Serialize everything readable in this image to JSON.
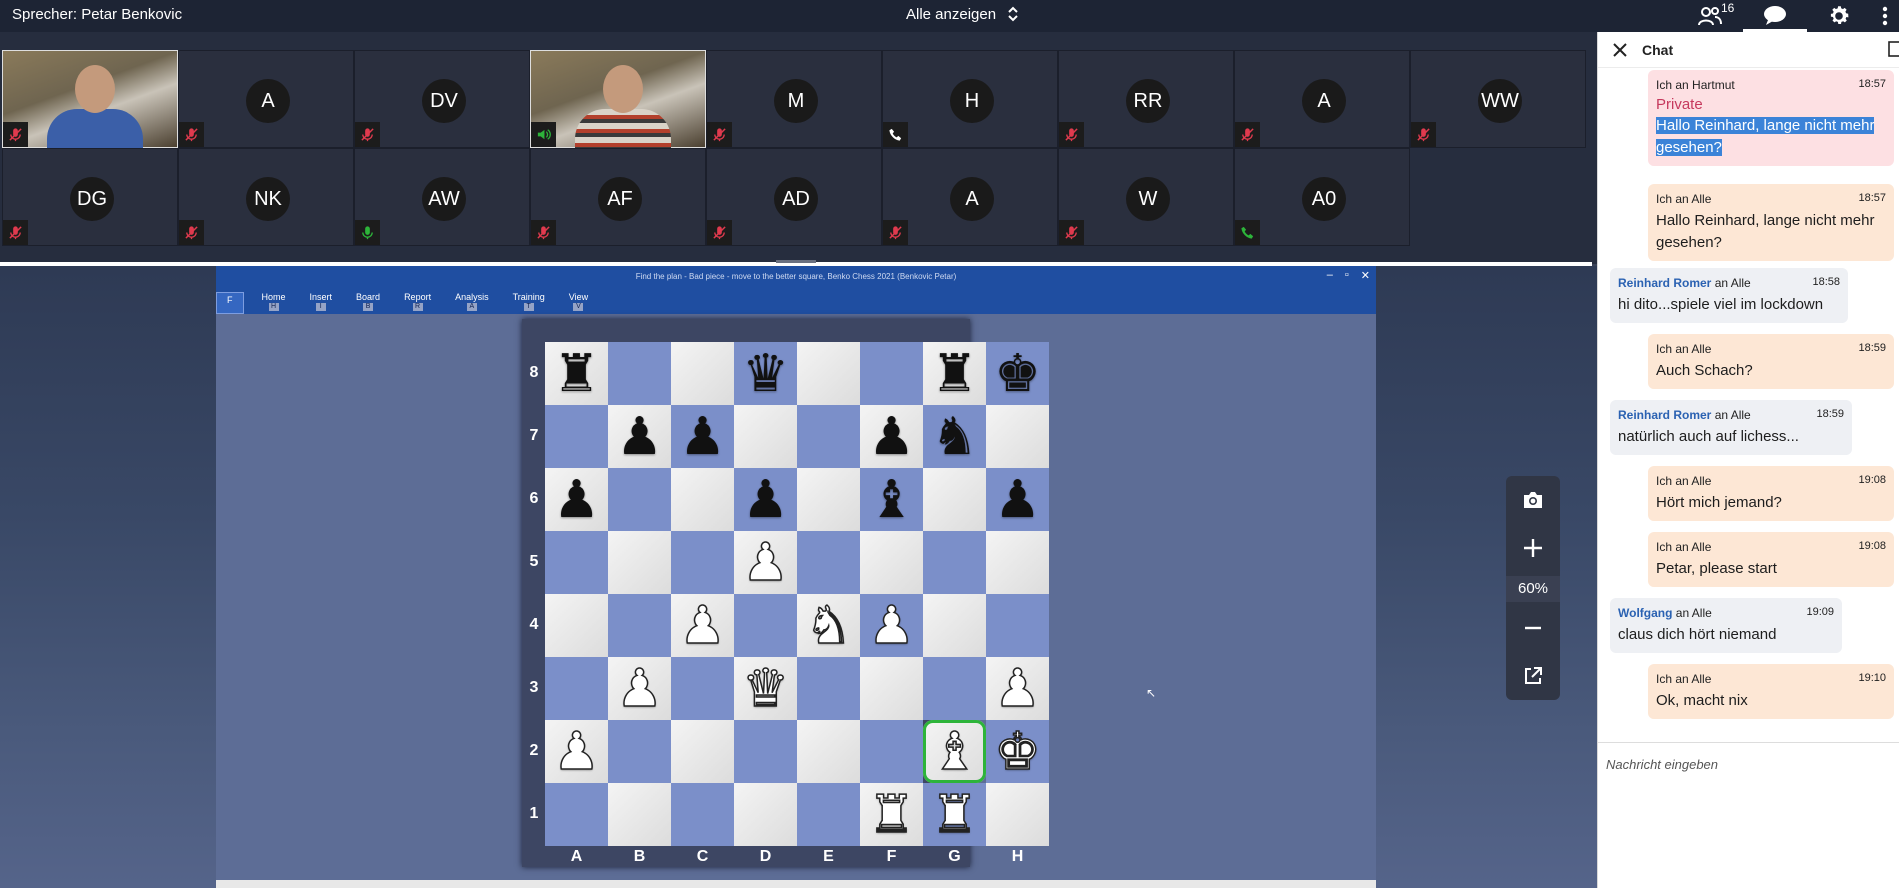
{
  "topbar": {
    "speaker": "Sprecher: Petar Benkovic",
    "layout_label": "Alle anzeigen",
    "participant_count": "16"
  },
  "participants": [
    {
      "initials": "",
      "video": true,
      "audio": "muted"
    },
    {
      "initials": "A",
      "video": false,
      "audio": "muted"
    },
    {
      "initials": "DV",
      "video": false,
      "audio": "muted"
    },
    {
      "initials": "",
      "video": true,
      "audio": "speaking"
    },
    {
      "initials": "M",
      "video": false,
      "audio": "muted"
    },
    {
      "initials": "H",
      "video": false,
      "audio": "phone"
    },
    {
      "initials": "RR",
      "video": false,
      "audio": "muted"
    },
    {
      "initials": "A",
      "video": false,
      "audio": "muted"
    },
    {
      "initials": "WW",
      "video": false,
      "audio": "muted"
    },
    {
      "initials": "DG",
      "video": false,
      "audio": "muted"
    },
    {
      "initials": "NK",
      "video": false,
      "audio": "muted"
    },
    {
      "initials": "AW",
      "video": false,
      "audio": "mic-on"
    },
    {
      "initials": "AF",
      "video": false,
      "audio": "muted"
    },
    {
      "initials": "AD",
      "video": false,
      "audio": "muted"
    },
    {
      "initials": "A",
      "video": false,
      "audio": "muted"
    },
    {
      "initials": "W",
      "video": false,
      "audio": "muted"
    },
    {
      "initials": "A0",
      "video": false,
      "audio": "phone-active"
    }
  ],
  "shared_window": {
    "caption": "Find the plan - Bad piece - move to the better square, Benko Chess 2021  (Benkovic Petar)",
    "ribbon_tabs": [
      {
        "label": "F",
        "key": ""
      },
      {
        "label": "Home",
        "key": "H"
      },
      {
        "label": "Insert",
        "key": "I"
      },
      {
        "label": "Board",
        "key": "B"
      },
      {
        "label": "Report",
        "key": "R"
      },
      {
        "label": "Analysis",
        "key": "A"
      },
      {
        "label": "Training",
        "key": "T"
      },
      {
        "label": "View",
        "key": "V"
      }
    ]
  },
  "board": {
    "ranks": [
      "8",
      "7",
      "6",
      "5",
      "4",
      "3",
      "2",
      "1"
    ],
    "files": [
      "A",
      "B",
      "C",
      "D",
      "E",
      "F",
      "G",
      "H"
    ],
    "rows": [
      [
        "br",
        "",
        "",
        "bq",
        "",
        "",
        "br",
        "bk"
      ],
      [
        "",
        "bp",
        "bp",
        "",
        "",
        "bp",
        "bn",
        ""
      ],
      [
        "bp",
        "",
        "",
        "bp",
        "",
        "bb",
        "",
        "bp"
      ],
      [
        "",
        "",
        "",
        "wp",
        "",
        "",
        "",
        ""
      ],
      [
        "",
        "",
        "wp",
        "",
        "wn",
        "wp",
        "",
        ""
      ],
      [
        "",
        "wp",
        "",
        "wq",
        "",
        "",
        "",
        "wp"
      ],
      [
        "wp",
        "",
        "",
        "",
        "",
        "",
        "wb",
        "wk"
      ],
      [
        "",
        "",
        "",
        "",
        "",
        "wr",
        "wr",
        ""
      ]
    ],
    "highlight": "g2"
  },
  "zoom": {
    "level": "60%"
  },
  "chat": {
    "title": "Chat",
    "input_placeholder": "Nachricht eingeben",
    "messages": [
      {
        "sender": "Ich",
        "to": "an Hartmut",
        "time": "18:57",
        "private_label": "Private",
        "text": "Hallo Reinhard, lange nicht mehr gesehen?"
      },
      {
        "sender": "Ich",
        "to": "an Alle",
        "time": "18:57",
        "text": "Hallo Reinhard, lange nicht mehr gesehen?"
      },
      {
        "sender": "Reinhard Romer",
        "to": "an Alle",
        "time": "18:58",
        "text": "hi dito...spiele viel im lockdown"
      },
      {
        "sender": "Ich",
        "to": "an Alle",
        "time": "18:59",
        "text": "Auch Schach?"
      },
      {
        "sender": "Reinhard Romer",
        "to": "an Alle",
        "time": "18:59",
        "text": "natürlich auch auf lichess..."
      },
      {
        "sender": "Ich",
        "to": "an Alle",
        "time": "19:08",
        "text": "Hört mich jemand?"
      },
      {
        "sender": "Ich",
        "to": "an Alle",
        "time": "19:08",
        "text": "Petar, please start"
      },
      {
        "sender": "Wolfgang",
        "to": "an Alle",
        "time": "19:09",
        "text": "claus dich hört niemand"
      },
      {
        "sender": "Ich",
        "to": "an Alle",
        "time": "19:10",
        "text": "Ok, macht nix"
      }
    ]
  }
}
